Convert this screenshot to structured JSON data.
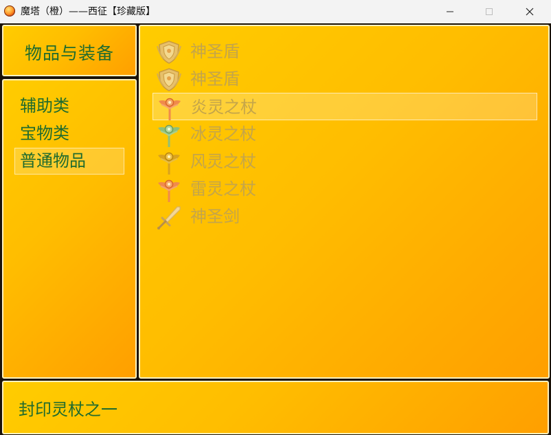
{
  "window": {
    "title": "魔塔（橙）——西征【珍藏版】"
  },
  "heading": "物品与装备",
  "categories": [
    "辅助类",
    "宝物类",
    "普通物品"
  ],
  "items": [
    {
      "label": "神圣盾",
      "icon": "shield-icon"
    },
    {
      "label": "神圣盾",
      "icon": "shield-icon"
    },
    {
      "label": "炎灵之杖",
      "icon": "fire-staff-icon"
    },
    {
      "label": "冰灵之杖",
      "icon": "ice-staff-icon"
    },
    {
      "label": "风灵之杖",
      "icon": "wind-staff-icon"
    },
    {
      "label": "雷灵之杖",
      "icon": "thunder-staff-icon"
    },
    {
      "label": "神圣剑",
      "icon": "sword-icon"
    }
  ],
  "selected_category": "普通物品",
  "selected_item": "炎灵之杖",
  "description": "封印灵杖之一",
  "colors": {
    "panel_gradient": [
      "#ffcc00",
      "#ff9f00"
    ],
    "heading_text": "#1f6b2e",
    "item_text": "#c4a54a",
    "panel_border": "#fff2c0",
    "fire_staff": "#f08a4b",
    "ice_staff": "#8fbf7a",
    "wind_staff": "#d9a21e",
    "thunder_staff": "#f08a4b"
  }
}
